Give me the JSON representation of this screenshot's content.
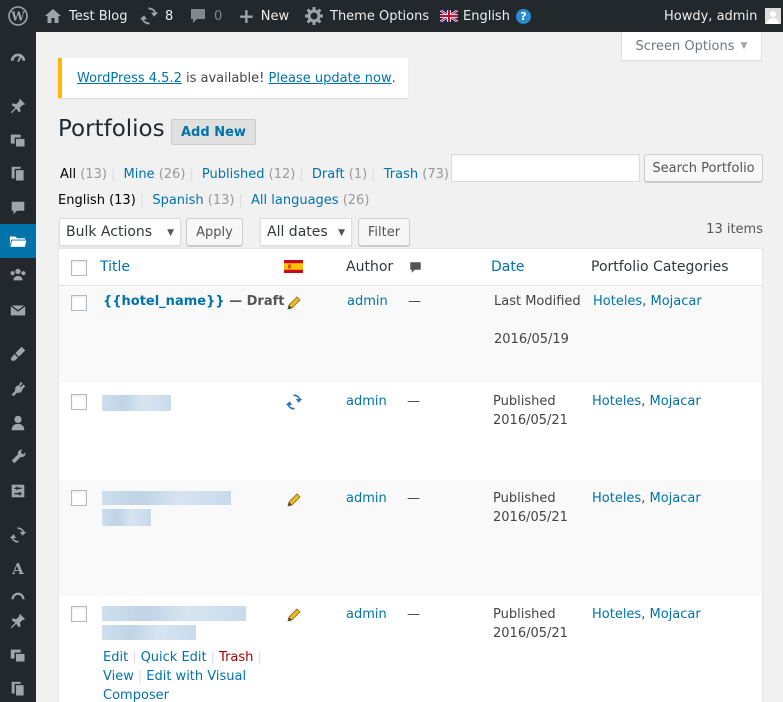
{
  "admin_bar": {
    "site_name": "Test Blog",
    "updates_count": "8",
    "comments_count": "0",
    "new_label": "New",
    "theme_options_label": "Theme Options",
    "language_label": "English",
    "howdy_label": "Howdy, admin"
  },
  "screen_options": {
    "label": "Screen Options"
  },
  "notice": {
    "version_link": "WordPress 4.5.2",
    "middle_text": " is available! ",
    "update_link": "Please update now",
    "end_text": "."
  },
  "page": {
    "title": "Portfolios",
    "add_new": "Add New"
  },
  "status_filters": [
    {
      "label": "All",
      "count": "(13)"
    },
    {
      "label": "Mine",
      "count": "(26)"
    },
    {
      "label": "Published",
      "count": "(12)"
    },
    {
      "label": "Draft",
      "count": "(1)"
    },
    {
      "label": "Trash",
      "count": "(73)"
    }
  ],
  "language_filters": [
    {
      "label": "English",
      "count": "(13)"
    },
    {
      "label": "Spanish",
      "count": "(13)"
    },
    {
      "label": "All languages",
      "count": "(26)"
    }
  ],
  "search": {
    "button": "Search Portfolio",
    "placeholder": ""
  },
  "tablenav": {
    "bulk_actions": "Bulk Actions",
    "apply": "Apply",
    "dates": "All dates",
    "filter": "Filter",
    "items_count": "13 items"
  },
  "columns": {
    "title": "Title",
    "author": "Author",
    "date": "Date",
    "categories": "Portfolio Categories"
  },
  "rows": [
    {
      "title": "{{hotel_name}}",
      "state": " — Draft",
      "lang_icon": "pencil-icon",
      "author": "admin",
      "comments": "—",
      "date_status": "Last Modified",
      "date": "2016/05/19",
      "cat1": "Hoteles",
      "cat2": "Mojacar"
    },
    {
      "title": "",
      "lang_icon": "sync-icon",
      "author": "admin",
      "comments": "—",
      "date_status": "Published",
      "date": "2016/05/21",
      "cat1": "Hoteles",
      "cat2": "Mojacar"
    },
    {
      "title": "",
      "lang_icon": "pencil-icon",
      "author": "admin",
      "comments": "—",
      "date_status": "Published",
      "date": "2016/05/21",
      "cat1": "Hoteles",
      "cat2": "Mojacar"
    },
    {
      "title": "",
      "lang_icon": "pencil-icon",
      "author": "admin",
      "comments": "—",
      "date_status": "Published",
      "date": "2016/05/21",
      "cat1": "Hoteles",
      "cat2": "Mojacar",
      "actions": {
        "edit": "Edit",
        "quick_edit": "Quick Edit",
        "trash": "Trash",
        "view": "View",
        "edit_visual": "Edit with Visual",
        "composer": "Composer"
      }
    }
  ],
  "colors": {
    "admin_bar_bg": "#23282d",
    "accent": "#0073aa",
    "notice_border": "#ffb900",
    "trash_red": "#a00"
  }
}
